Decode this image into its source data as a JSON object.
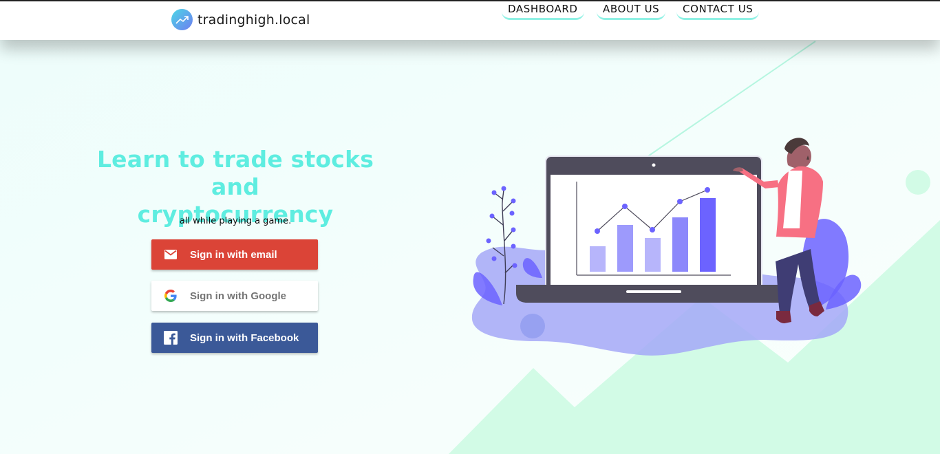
{
  "brand": {
    "name": "tradinghigh.local",
    "logo_icon": "trending-up-icon",
    "gradient": [
      "#4bd7e6",
      "#6f7df0"
    ]
  },
  "nav": {
    "items": [
      {
        "label": "DASHBOARD"
      },
      {
        "label": "ABOUT US"
      },
      {
        "label": "CONTACT US"
      }
    ]
  },
  "hero": {
    "title_line1": "Learn to trade stocks and",
    "title_line2": "cryptocurrency",
    "subtitle": "all while playing a game.",
    "title_color": "#5eede0"
  },
  "auth": {
    "email": {
      "label": "Sign in with email",
      "icon": "mail-icon",
      "color": "#db4437"
    },
    "google": {
      "label": "Sign in with Google",
      "icon": "google-icon",
      "color": "#ffffff"
    },
    "facebook": {
      "label": "Sign in with Facebook",
      "icon": "facebook-icon",
      "color": "#3b5998"
    }
  },
  "colors": {
    "background": "#f3fefb",
    "mint": "#d2fbe6",
    "accent_purple": "#6c63ff"
  }
}
